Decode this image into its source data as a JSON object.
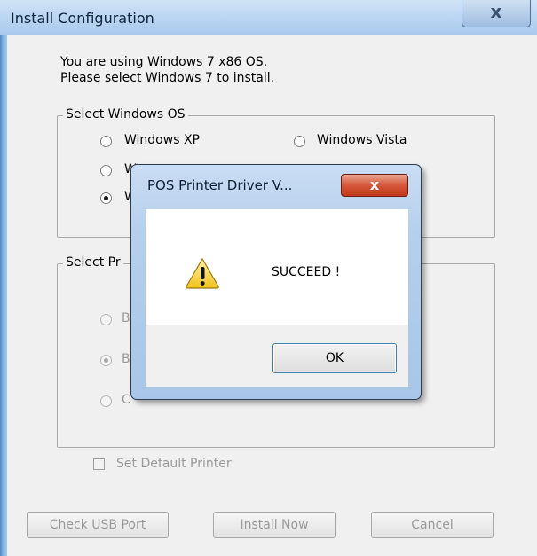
{
  "main_window": {
    "title": "Install Configuration",
    "close_glyph": "x",
    "message_line1": "You are using Windows 7 x86 OS.",
    "message_line2": "Please select Windows 7 to install.",
    "os_group": {
      "label": "Select Windows OS",
      "options": [
        {
          "label": "Windows XP",
          "selected": false
        },
        {
          "label": "Windows Vista",
          "selected": false
        },
        {
          "label": "Wi",
          "selected": false
        },
        {
          "label": "W",
          "selected": true
        }
      ]
    },
    "printer_group": {
      "label": "Select Pr",
      "options": [
        {
          "label": "B",
          "selected": false
        },
        {
          "label": "B",
          "selected": true
        },
        {
          "label": "C",
          "selected": false
        }
      ]
    },
    "set_default_label": "Set Default Printer",
    "buttons": {
      "check_usb": "Check USB Port",
      "install_now": "Install Now",
      "cancel": "Cancel"
    }
  },
  "dialog": {
    "title": "POS Printer Driver V...",
    "close_glyph": "x",
    "icon": "warning-icon",
    "message": "SUCCEED !",
    "ok_label": "OK"
  },
  "colors": {
    "title_bar": "#bcd6f2",
    "close_red": "#c2381b",
    "window_bg": "#f0f0f0"
  }
}
